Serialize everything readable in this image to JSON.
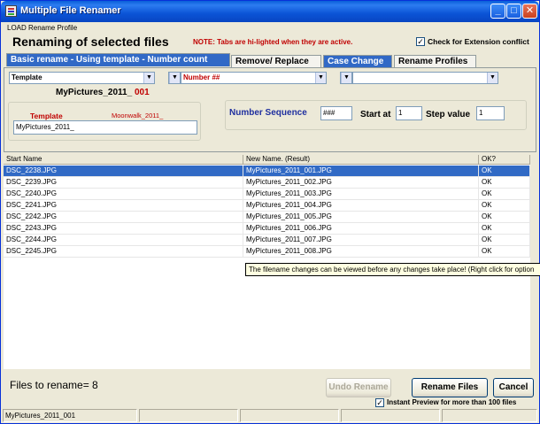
{
  "window": {
    "title": "Multiple File Renamer"
  },
  "titlebar_buttons": {
    "minimize": "_",
    "maximize": "□",
    "close": "✕"
  },
  "menu": {
    "load_profile": "LOAD Rename Profile"
  },
  "header": {
    "heading": "Renaming of selected files",
    "note": "NOTE: Tabs are hi-lighted when they are active.",
    "ext_conflict_label": "Check for Extension conflict",
    "ext_conflict_checked": true
  },
  "tabs": [
    {
      "label": "Basic rename - Using template - Number count",
      "active": true
    },
    {
      "label": "Remove/ Replace",
      "active": false
    },
    {
      "label": "Case Change",
      "active": true
    },
    {
      "label": "Rename Profiles",
      "active": false
    }
  ],
  "basic": {
    "combo1": "Template",
    "combo2": "",
    "combo3": "Number ##",
    "combo4": "",
    "combo5": "",
    "preview_name": "MyPictures_2011_",
    "preview_num": "001",
    "template_label": "Template",
    "template_hint": "Moonwalk_2011_",
    "template_value": "MyPictures_2011_",
    "number_sequence_label": "Number Sequence",
    "number_sequence_value": "###",
    "start_at_label": "Start at",
    "start_at_value": "1",
    "step_value_label": "Step value",
    "step_value_value": "1"
  },
  "grid": {
    "columns": [
      "Start Name",
      "New Name. (Result)",
      "OK?"
    ],
    "rows": [
      [
        "DSC_2238.JPG",
        "MyPictures_2011_001.JPG",
        "OK"
      ],
      [
        "DSC_2239.JPG",
        "MyPictures_2011_002.JPG",
        "OK"
      ],
      [
        "DSC_2240.JPG",
        "MyPictures_2011_003.JPG",
        "OK"
      ],
      [
        "DSC_2241.JPG",
        "MyPictures_2011_004.JPG",
        "OK"
      ],
      [
        "DSC_2242.JPG",
        "MyPictures_2011_005.JPG",
        "OK"
      ],
      [
        "DSC_2243.JPG",
        "MyPictures_2011_006.JPG",
        "OK"
      ],
      [
        "DSC_2244.JPG",
        "MyPictures_2011_007.JPG",
        "OK"
      ],
      [
        "DSC_2245.JPG",
        "MyPictures_2011_008.JPG",
        "OK"
      ]
    ]
  },
  "tooltip": "The filename changes can be viewed before any changes take place! (Right click for option",
  "footer": {
    "files_to_rename": "Files to rename= 8",
    "undo_label": "Undo Rename",
    "rename_label": "Rename Files",
    "cancel_label": "Cancel",
    "instant_preview_label": "Instant Preview for more than 100 files",
    "instant_preview_checked": true
  },
  "statusbar": {
    "panel1": "MyPictures_2011_001"
  },
  "colors": {
    "accent": "#3169c6",
    "selected_row": "#316ac5",
    "red_label": "#c00000",
    "navy_label": "#1f2f9f"
  }
}
